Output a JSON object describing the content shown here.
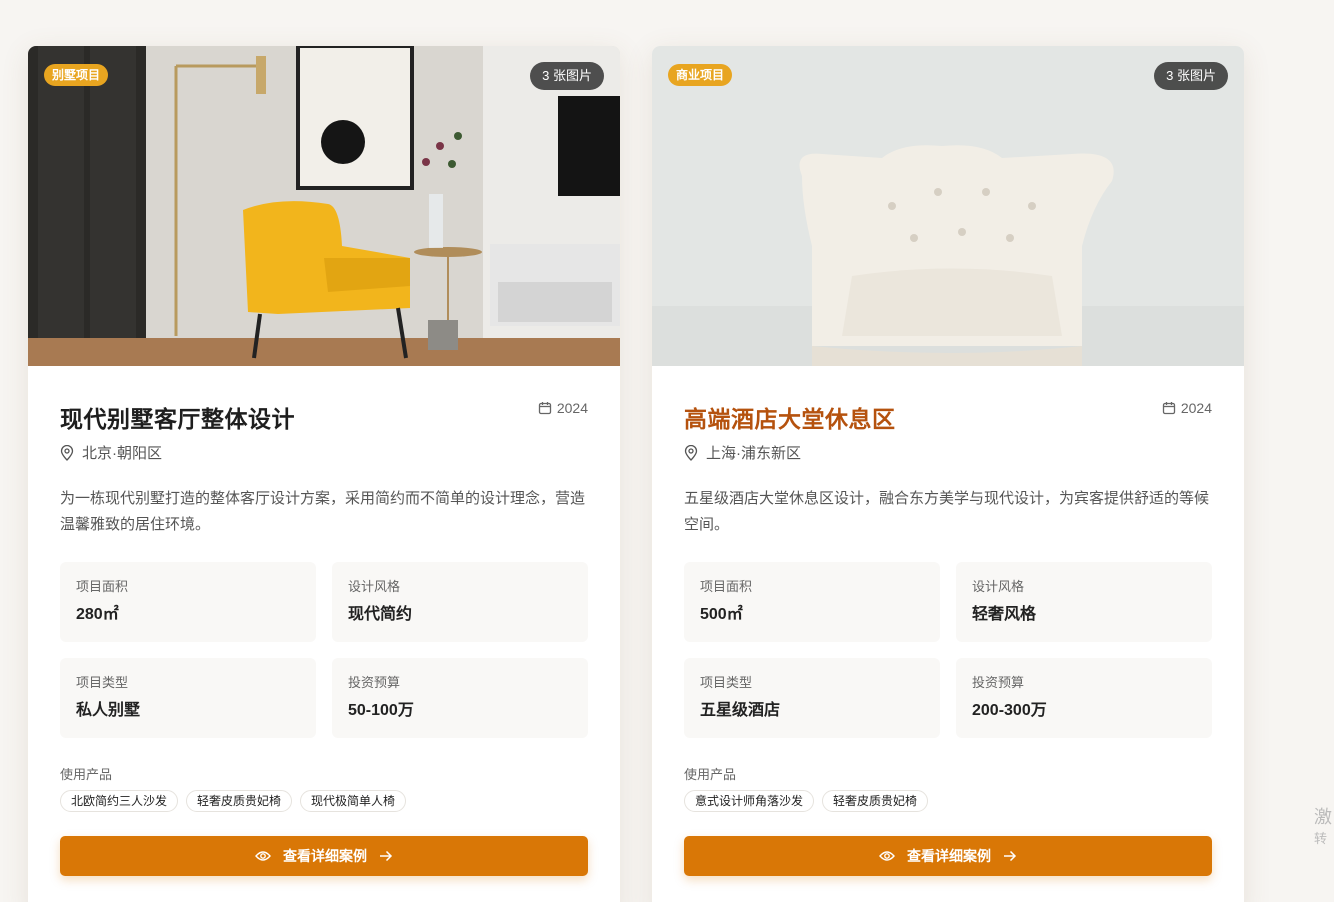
{
  "projects": [
    {
      "badge": "别墅项目",
      "photo_count": "3 张图片",
      "title": "现代别墅客厅整体设计",
      "year": "2024",
      "location": "北京·朝阳区",
      "description": "为一栋现代别墅打造的整体客厅设计方案，采用简约而不简单的设计理念，营造温馨雅致的居住环境。",
      "stats": [
        {
          "label": "项目面积",
          "value": "280㎡"
        },
        {
          "label": "设计风格",
          "value": "现代简约"
        },
        {
          "label": "项目类型",
          "value": "私人别墅"
        },
        {
          "label": "投资预算",
          "value": "50-100万"
        }
      ],
      "products_label": "使用产品",
      "products": [
        "北欧简约三人沙发",
        "轻奢皮质贵妃椅",
        "现代极简单人椅"
      ],
      "cta_label": "查看详细案例"
    },
    {
      "badge": "商业项目",
      "photo_count": "3 张图片",
      "title": "高端酒店大堂休息区",
      "year": "2024",
      "location": "上海·浦东新区",
      "description": "五星级酒店大堂休息区设计，融合东方美学与现代设计，为宾客提供舒适的等候空间。",
      "stats": [
        {
          "label": "项目面积",
          "value": "500㎡"
        },
        {
          "label": "设计风格",
          "value": "轻奢风格"
        },
        {
          "label": "项目类型",
          "value": "五星级酒店"
        },
        {
          "label": "投资预算",
          "value": "200-300万"
        }
      ],
      "products_label": "使用产品",
      "products": [
        "意式设计师角落沙发",
        "轻奢皮质贵妃椅"
      ],
      "cta_label": "查看详细案例"
    }
  ],
  "side_text": {
    "line1": "激",
    "line2": "转"
  },
  "colors": {
    "accent": "#d97706",
    "badge": "#e8a520",
    "highlight_title": "#b5520e",
    "page_bg": "#f7f5f2"
  },
  "icons": {
    "calendar": "calendar-icon",
    "location": "map-pin-icon",
    "view": "eye-icon",
    "arrow": "arrow-right-icon"
  }
}
